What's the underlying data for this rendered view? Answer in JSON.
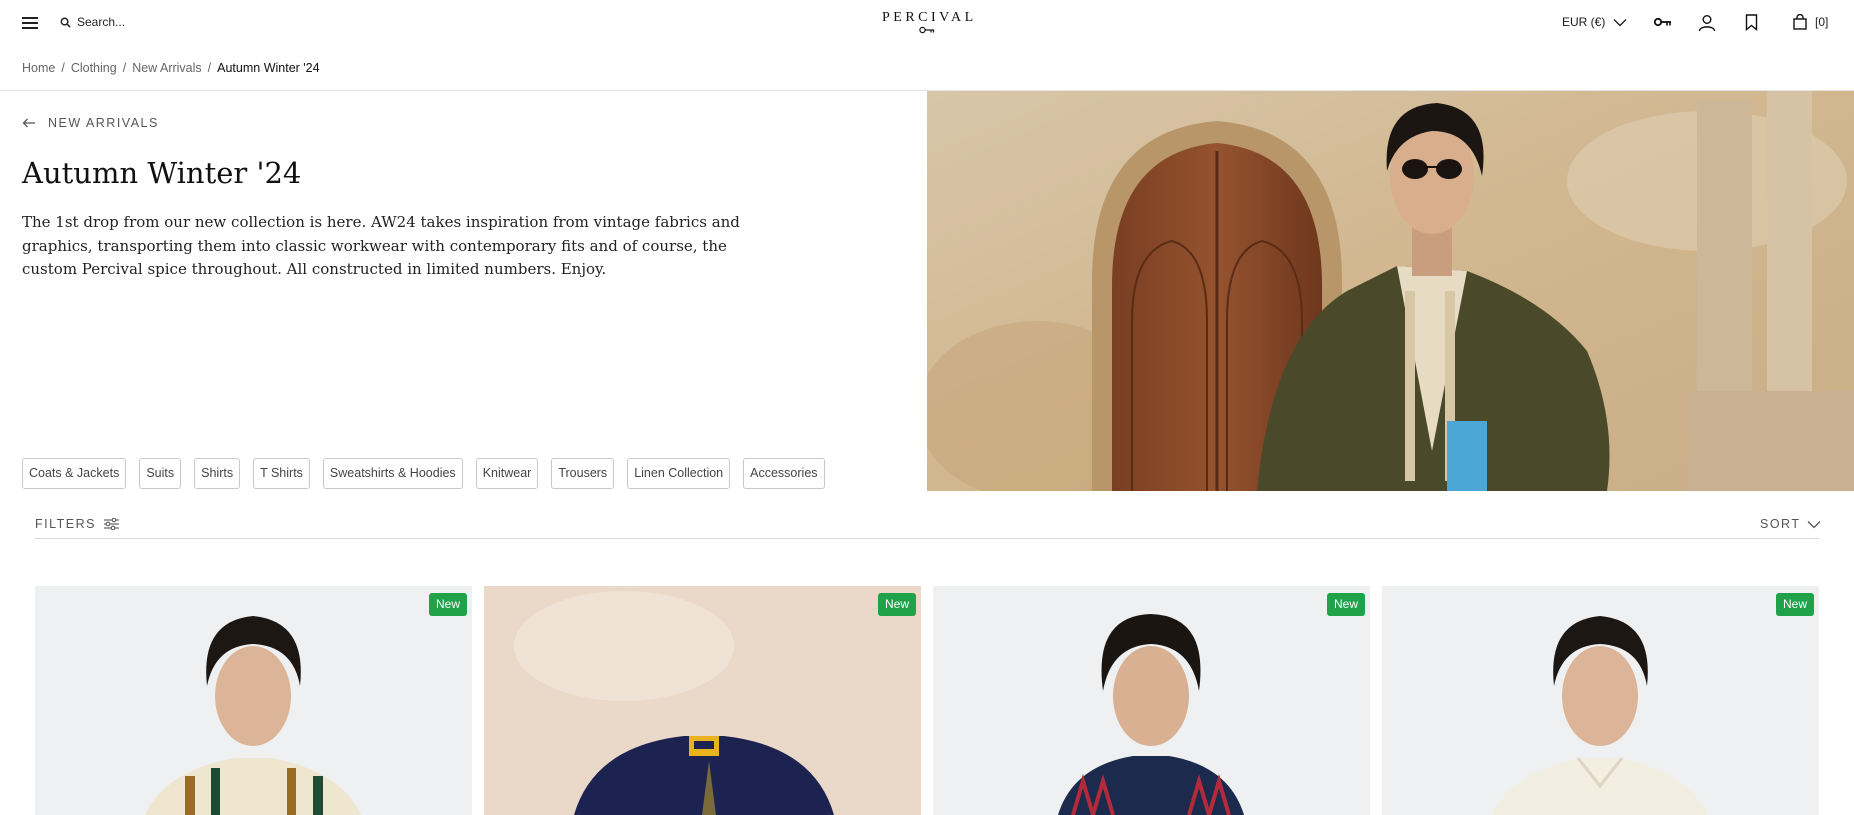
{
  "header": {
    "search_placeholder": "Search...",
    "logo": "PERCIVAL",
    "currency": "EUR (€)",
    "bag_count": "[0]"
  },
  "breadcrumb": {
    "items": [
      "Home",
      "Clothing",
      "New Arrivals",
      "Autumn Winter '24"
    ],
    "separator": "/"
  },
  "hero": {
    "back_label": "NEW ARRIVALS",
    "title": "Autumn Winter '24",
    "description": "The 1st drop from our new collection is here. AW24 takes inspiration from vintage fabrics and graphics, transporting them into classic workwear with contemporary fits and of course, the custom Percival spice throughout. All constructed in limited numbers. Enjoy."
  },
  "categories": [
    "Coats & Jackets",
    "Suits",
    "Shirts",
    "T Shirts",
    "Sweatshirts & Hoodies",
    "Knitwear",
    "Trousers",
    "Linen Collection",
    "Accessories"
  ],
  "toolbar": {
    "filters_label": "FILTERS",
    "sort_label": "SORT"
  },
  "products": [
    {
      "badge": "New"
    },
    {
      "badge": "New"
    },
    {
      "badge": "New"
    },
    {
      "badge": "New"
    }
  ],
  "colors": {
    "badge": "#1fa24a",
    "text": "#1a1a1a"
  },
  "icons": [
    "menu-icon",
    "search-icon",
    "key-icon",
    "chevron-down-icon",
    "account-icon",
    "bookmark-icon",
    "bag-icon",
    "arrow-left-icon",
    "sliders-icon"
  ]
}
